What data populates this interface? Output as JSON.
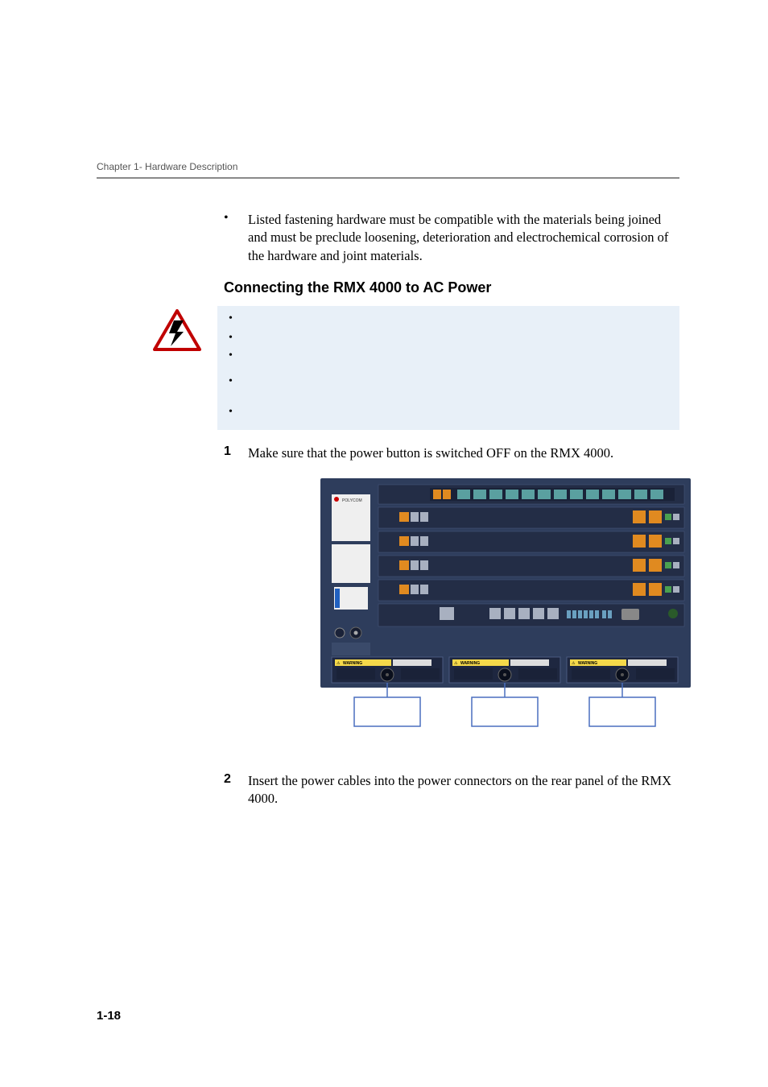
{
  "running_header": "Chapter 1- Hardware Description",
  "bullet_intro": "Listed fastening hardware must be compatible with the materials being joined and must be preclude loosening, deterioration and electrochemical corrosion of the hardware and joint materials.",
  "section_heading": "Connecting the RMX 4000 to AC Power",
  "warning_icon": "electrical-hazard-warning",
  "warning_items": [
    "",
    "",
    "",
    "",
    ""
  ],
  "steps": [
    {
      "num": "1",
      "text": "Make sure that the power button is switched OFF on the RMX 4000."
    },
    {
      "num": "2",
      "text": "Insert the power cables into the power connectors on the rear panel of the RMX 4000."
    }
  ],
  "figure": {
    "name": "rmx-4000-rear-panel",
    "labels": {
      "logo": "POLYCOM",
      "psu_warning": "WARNING",
      "psu_warning_icon": "⚠"
    }
  },
  "page_number": "1-18"
}
